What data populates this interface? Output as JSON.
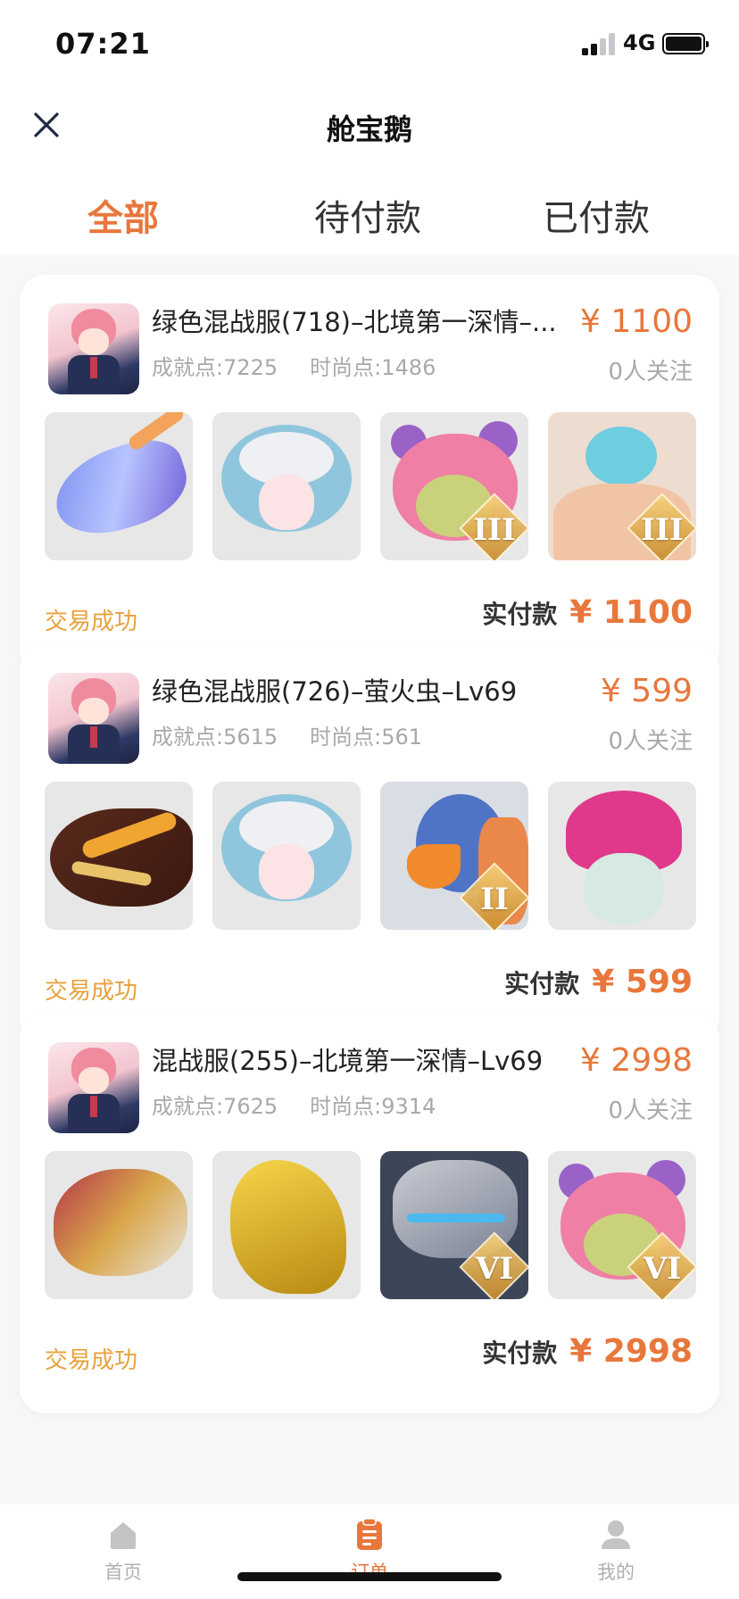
{
  "status_bar": {
    "time": "07:21",
    "network": "4G"
  },
  "nav": {
    "title": "舱宝鹅",
    "close_icon": "close-icon"
  },
  "tabs": [
    {
      "label": "全部",
      "active": true
    },
    {
      "label": "待付款",
      "active": false
    },
    {
      "label": "已付款",
      "active": false
    }
  ],
  "orders": [
    {
      "title": "绿色混战服(718)–北境第一深情–...",
      "achievement": "成就点:7225",
      "fashion": "时尚点:1486",
      "price": "¥ 1100",
      "followers": "0人关注",
      "status": "交易成功",
      "paid_label": "实付款",
      "paid_amount": "¥ 1100",
      "thumbnails": [
        {
          "name": "blue-dragon-mount",
          "badge": ""
        },
        {
          "name": "cloud-hair-girl",
          "badge": ""
        },
        {
          "name": "pink-bear-hood",
          "badge": "III"
        },
        {
          "name": "blue-bird-muscle",
          "badge": "III"
        }
      ]
    },
    {
      "title": "绿色混战服(726)–萤火虫–Lv69",
      "achievement": "成就点:5615",
      "fashion": "时尚点:561",
      "price": "¥ 599",
      "followers": "0人关注",
      "status": "交易成功",
      "paid_label": "实付款",
      "paid_amount": "¥ 599",
      "thumbnails": [
        {
          "name": "fire-dragon-head",
          "badge": ""
        },
        {
          "name": "cloud-hair-girl",
          "badge": ""
        },
        {
          "name": "griffin-eagle",
          "badge": "II"
        },
        {
          "name": "mushroom-hat-kid",
          "badge": ""
        }
      ]
    },
    {
      "title": "混战服(255)–北境第一深情–Lv69",
      "achievement": "成就点:7625",
      "fashion": "时尚点:9314",
      "price": "¥ 2998",
      "followers": "0人关注",
      "status": "交易成功",
      "paid_label": "实付款",
      "paid_amount": "¥ 2998",
      "thumbnails": [
        {
          "name": "red-gold-dragon",
          "badge": ""
        },
        {
          "name": "golden-phoenix",
          "badge": ""
        },
        {
          "name": "stone-golem",
          "badge": "VI"
        },
        {
          "name": "pink-bear-hood",
          "badge": "VI"
        }
      ]
    }
  ],
  "tabbar": [
    {
      "label": "首页",
      "icon": "home-icon",
      "active": false
    },
    {
      "label": "订单",
      "icon": "orders-icon",
      "active": true
    },
    {
      "label": "我的",
      "icon": "profile-icon",
      "active": false
    }
  ],
  "colors": {
    "accent": "#e8773c",
    "status": "#e8a03c",
    "muted": "#a9a9a9"
  }
}
